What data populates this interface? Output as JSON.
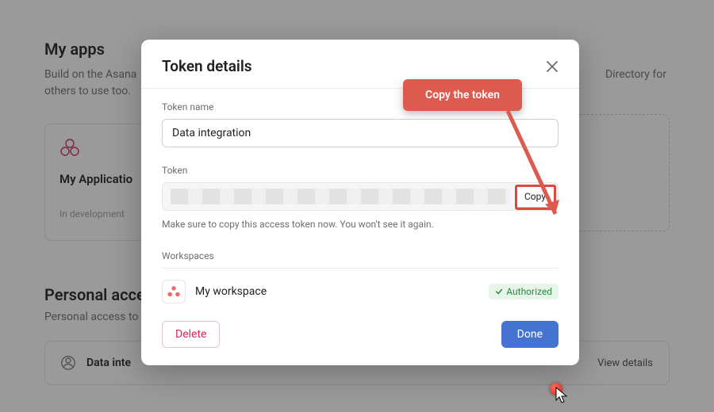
{
  "background": {
    "heading": "My apps",
    "subtext_left": "Build on the Asana",
    "subtext_trail": "others to use too.",
    "subtext_right": "Directory for",
    "app_card": {
      "title": "My Applicatio",
      "status": "In development"
    },
    "section2_heading": "Personal acce",
    "section2_sub": "Personal access to",
    "token_row": {
      "name": "Data inte",
      "view_label": "View details"
    }
  },
  "modal": {
    "title": "Token details",
    "token_name_label": "Token name",
    "token_name_value": "Data integration",
    "token_label": "Token",
    "copy_label": "Copy",
    "token_hint": "Make sure to copy this access token now. You won't see it again.",
    "workspaces_label": "Workspaces",
    "workspace": {
      "name": "My workspace",
      "status": "Authorized"
    },
    "delete_label": "Delete",
    "done_label": "Done"
  },
  "callout": {
    "text": "Copy the token"
  }
}
